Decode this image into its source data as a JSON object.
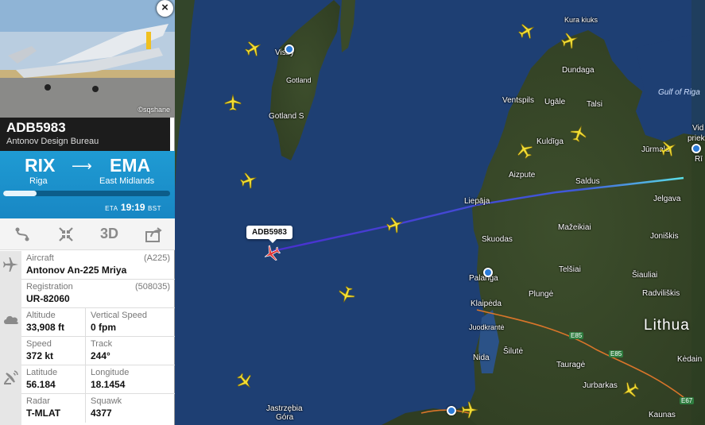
{
  "flight": {
    "callsign": "ADB5983",
    "airline": "Antonov Design Bureau",
    "photo_credit": "©sqshane",
    "map_label": "ADB5983"
  },
  "route": {
    "origin_code": "RIX",
    "origin_city": "Riga",
    "dest_code": "EMA",
    "dest_city": "East Midlands",
    "eta_label": "ETA",
    "eta_time": "19:19",
    "eta_zone": "BST",
    "progress": 0.2
  },
  "toolbar": {
    "route_icon": "route-icon",
    "fit_icon": "fit-view-icon",
    "view_3d_label": "3D",
    "share_icon": "share-icon"
  },
  "details": {
    "aircraft_label": "Aircraft",
    "aircraft_code": "(A225)",
    "aircraft_value": "Antonov An-225 Mriya",
    "registration_label": "Registration",
    "registration_code": "(508035)",
    "registration_value": "UR-82060",
    "altitude_label": "Altitude",
    "altitude_value": "33,908 ft",
    "vspeed_label": "Vertical Speed",
    "vspeed_value": "0 fpm",
    "speed_label": "Speed",
    "speed_value": "372 kt",
    "track_label": "Track",
    "track_value": "244°",
    "lat_label": "Latitude",
    "lat_value": "56.184",
    "lon_label": "Longitude",
    "lon_value": "18.1454",
    "radar_label": "Radar",
    "radar_value": "T-MLAT",
    "squawk_label": "Squawk",
    "squawk_value": "4377"
  },
  "map": {
    "colors": {
      "sea": "#1e3f73",
      "land": "#3b4b2c",
      "track_start": "#5be0e8",
      "track_end": "#4a2fd0",
      "plane": "#f2de35"
    },
    "places": {
      "visby": "Visby",
      "gotland": "Gotland",
      "gotland_s": "Gotland S",
      "kura": "Kura kiuks",
      "dundaga": "Dundaga",
      "ventspils": "Ventspils",
      "ugale": "Ugāle",
      "talsi": "Talsi",
      "gulf": "Gulf of Riga",
      "vid": "Vid",
      "priek": "priek",
      "kuldiga": "Kuldīga",
      "jurmala": "Jūrmala",
      "ri": "Rī",
      "aizpute": "Aizpute",
      "saldus": "Saldus",
      "liepaja": "Liepāja",
      "jelgava": "Jelgava",
      "skuodas": "Skuodas",
      "mazeikiai": "Mažeikiai",
      "joniskis": "Joniškis",
      "palanga": "Palanga",
      "telsiai": "Telšiai",
      "siauliai": "Šiauliai",
      "plunge": "Plungė",
      "radviliskis": "Radviliškis",
      "klaipeda": "Klaipėda",
      "juodkrante": "Juodkrantė",
      "lithuania": "Lithua",
      "silute": "Šilutė",
      "nida": "Nida",
      "taurage": "Tauragė",
      "kedain": "Kėdain",
      "jurbarkas": "Jurbarkas",
      "jastrzebia": "Jastrzębia",
      "gora": "Góra",
      "kaunas": "Kaunas",
      "e85": "E85",
      "e67": "E67"
    }
  }
}
